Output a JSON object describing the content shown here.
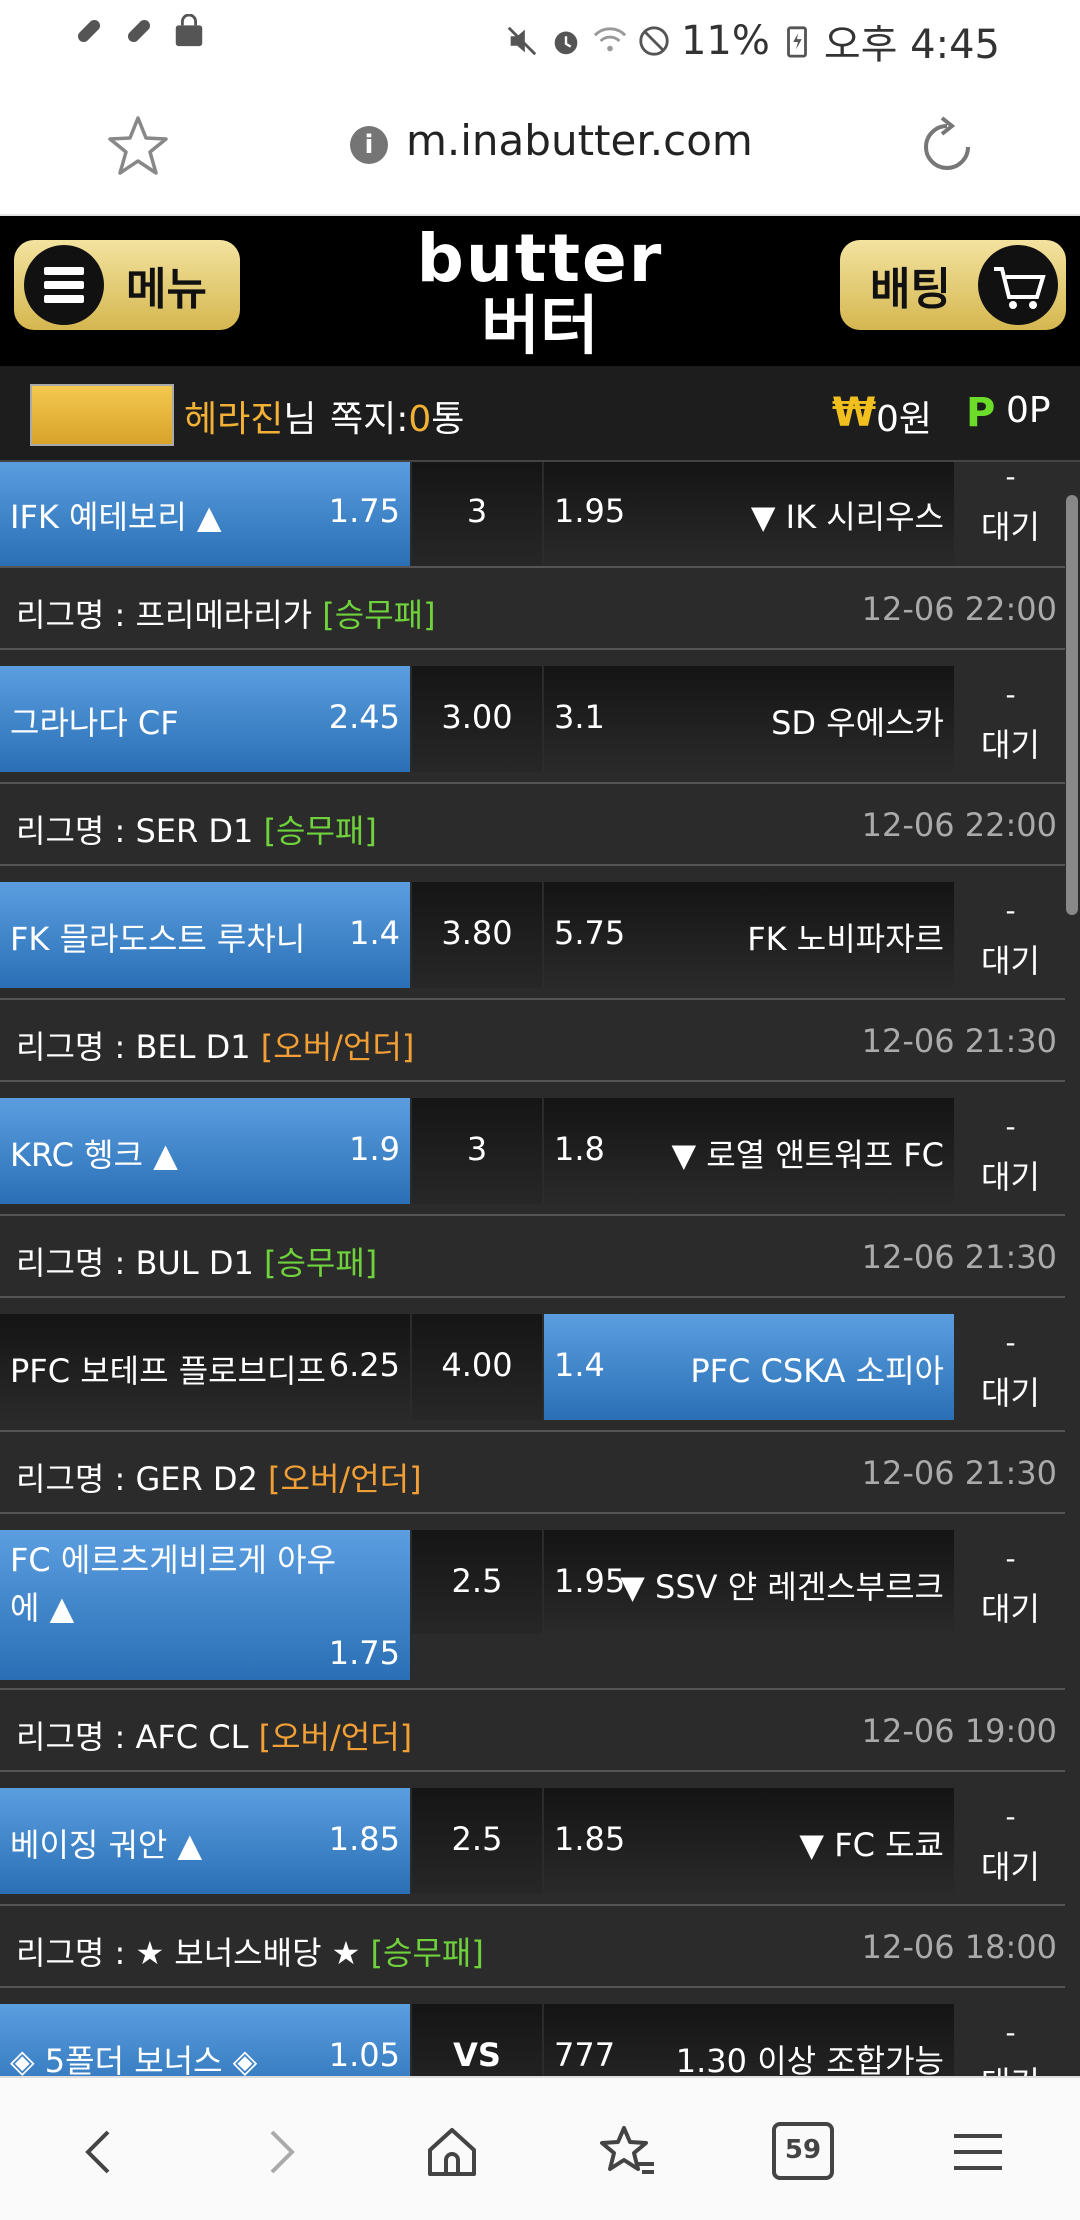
{
  "status_bar": {
    "battery": "11%",
    "time": "오후 4:45"
  },
  "browser": {
    "url": "m.inabutter.com",
    "tabs_count": "59"
  },
  "header": {
    "menu_label": "메뉴",
    "bet_label": "배팅",
    "logo_en": "butter",
    "logo_ko": "버터"
  },
  "user": {
    "name": "헤라진",
    "suffix": "님",
    "msg_label": "쪽지:",
    "msg_count": "0",
    "msg_unit": "통",
    "won_symbol": "₩",
    "won_value": "0원",
    "point_symbol": "P",
    "point_value": "0P"
  },
  "rows": [
    {
      "type": "match",
      "home": "IFK 예테보리 ▲",
      "home_odds": "1.75",
      "draw": "3",
      "away_odds": "1.95",
      "away": "▼ IK 시리우스",
      "status_top": "-",
      "status": "대기",
      "sel": "home"
    },
    {
      "type": "league",
      "name": "리그명 : 프리메라리가",
      "tag": "[승무패]",
      "tag_color": "green",
      "time": "12-06 22:00"
    },
    {
      "type": "match",
      "home": "그라나다 CF",
      "home_odds": "2.45",
      "draw": "3.00",
      "away_odds": "3.1",
      "away": "SD 우에스카",
      "status_top": "-",
      "status": "대기",
      "sel": "home"
    },
    {
      "type": "league",
      "name": "리그명 : SER D1",
      "tag": "[승무패]",
      "tag_color": "green",
      "time": "12-06 22:00"
    },
    {
      "type": "match",
      "home": "FK 믈라도스트 루차니",
      "home_odds": "1.4",
      "draw": "3.80",
      "away_odds": "5.75",
      "away": "FK 노비파자르",
      "status_top": "-",
      "status": "대기",
      "sel": "home"
    },
    {
      "type": "league",
      "name": "리그명 : BEL D1",
      "tag": "[오버/언더]",
      "tag_color": "orange",
      "time": "12-06 21:30"
    },
    {
      "type": "match",
      "home": "KRC 헹크 ▲",
      "home_odds": "1.9",
      "draw": "3",
      "away_odds": "1.8",
      "away": "▼ 로열 앤트워프 FC",
      "status_top": "-",
      "status": "대기",
      "sel": "home"
    },
    {
      "type": "league",
      "name": "리그명 : BUL D1",
      "tag": "[승무패]",
      "tag_color": "green",
      "time": "12-06 21:30"
    },
    {
      "type": "match",
      "home": "PFC 보테프 플로브디프",
      "home_odds": "6.25",
      "draw": "4.00",
      "away_odds": "1.4",
      "away": "PFC CSKA 소피아",
      "status_top": "-",
      "status": "대기",
      "sel": "away"
    },
    {
      "type": "league",
      "name": "리그명 : GER D2",
      "tag": "[오버/언더]",
      "tag_color": "orange",
      "time": "12-06 21:30"
    },
    {
      "type": "match",
      "home": "FC 에르츠게비르게 아우에 ▲",
      "home_odds": "1.75",
      "draw": "2.5",
      "away_odds": "1.95",
      "away": "▼ SSV 얀 레겐스부르크",
      "status_top": "-",
      "status": "대기",
      "sel": "home"
    },
    {
      "type": "league",
      "name": "리그명 : AFC CL",
      "tag": "[오버/언더]",
      "tag_color": "orange",
      "time": "12-06 19:00"
    },
    {
      "type": "match",
      "home": "베이징 궈안 ▲",
      "home_odds": "1.85",
      "draw": "2.5",
      "away_odds": "1.85",
      "away": "▼ FC 도쿄",
      "status_top": "-",
      "status": "대기",
      "sel": "home"
    },
    {
      "type": "league",
      "name": "리그명 : ★ 보너스배당 ★",
      "tag": "[승무패]",
      "tag_color": "green",
      "time": "12-06 18:00"
    },
    {
      "type": "match",
      "home": "◈ 5폴더 보너스 ◈",
      "home_odds": "1.05",
      "draw": "VS",
      "away_odds": "777",
      "away": "1.30 이상 조합가능",
      "status_top": "-",
      "status": "대기",
      "sel": "home"
    }
  ]
}
